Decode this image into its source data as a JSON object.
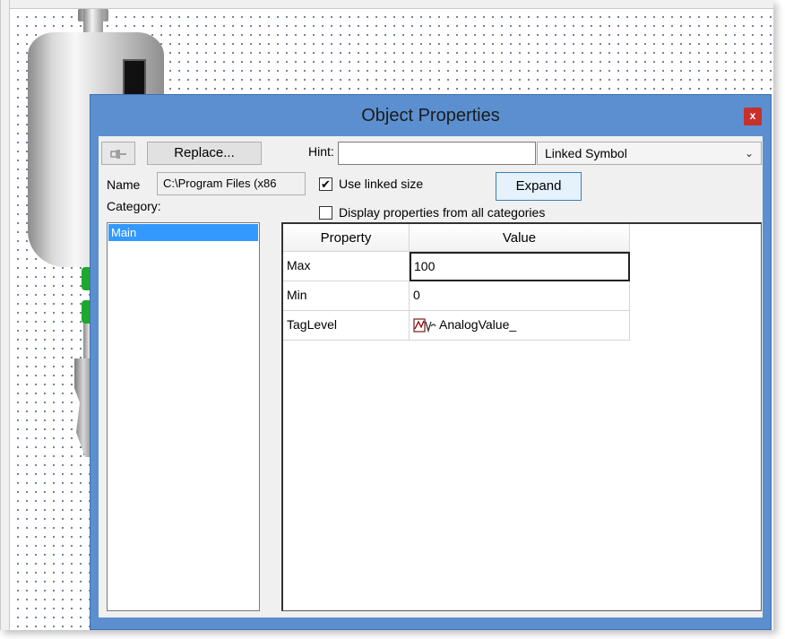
{
  "dialog": {
    "title": "Object Properties",
    "close_glyph": "x",
    "pin_icon": "pushpin-icon",
    "replace_label": "Replace...",
    "hint_label": "Hint:",
    "hint_value": "",
    "symbol_type": "Linked Symbol",
    "name_label": "Name",
    "name_value": "C:\\Program Files (x86",
    "use_linked_size_label": "Use linked size",
    "use_linked_size_checked": true,
    "expand_label": "Expand",
    "category_label": "Category:",
    "display_all_label": "Display properties from all categories",
    "display_all_checked": false
  },
  "categories": [
    "Main"
  ],
  "grid": {
    "headers": {
      "property": "Property",
      "value": "Value"
    },
    "rows": [
      {
        "property": "Max",
        "value": "100"
      },
      {
        "property": "Min",
        "value": "0"
      },
      {
        "property": "TagLevel",
        "value": "AnalogValue_"
      }
    ]
  },
  "colors": {
    "dialog_frame": "#5b8fd0",
    "close_button": "#c7312b",
    "selection": "#3399ff",
    "valve": "#1ea82d"
  }
}
